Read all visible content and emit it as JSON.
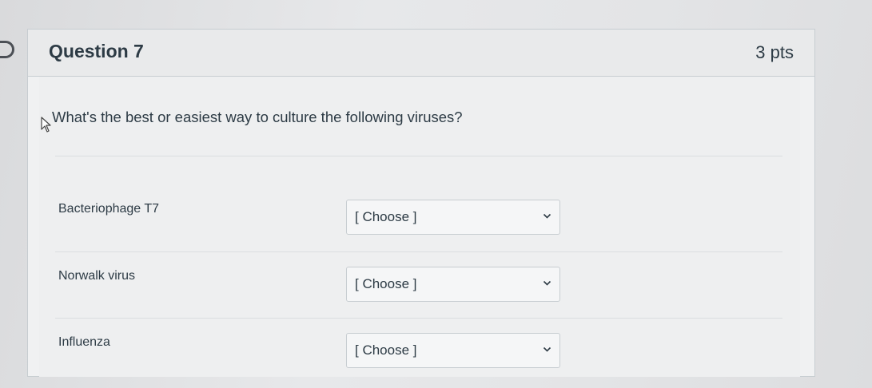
{
  "question": {
    "title": "Question 7",
    "points": "3 pts",
    "prompt": "What's the best or easiest way to culture the following viruses?",
    "answers": [
      {
        "label": "Bacteriophage T7",
        "selected": "[ Choose ]"
      },
      {
        "label": "Norwalk virus",
        "selected": "[ Choose ]"
      },
      {
        "label": "Influenza",
        "selected": "[ Choose ]"
      }
    ]
  },
  "icons": {
    "cursor": "mouse-pointer-icon",
    "dropdown": "chevron-down-icon",
    "flag": "bookmark-tab-icon"
  },
  "colors": {
    "text": "#2d3b45",
    "border": "#c7cdd1",
    "card_background": "#f0f1f2"
  }
}
